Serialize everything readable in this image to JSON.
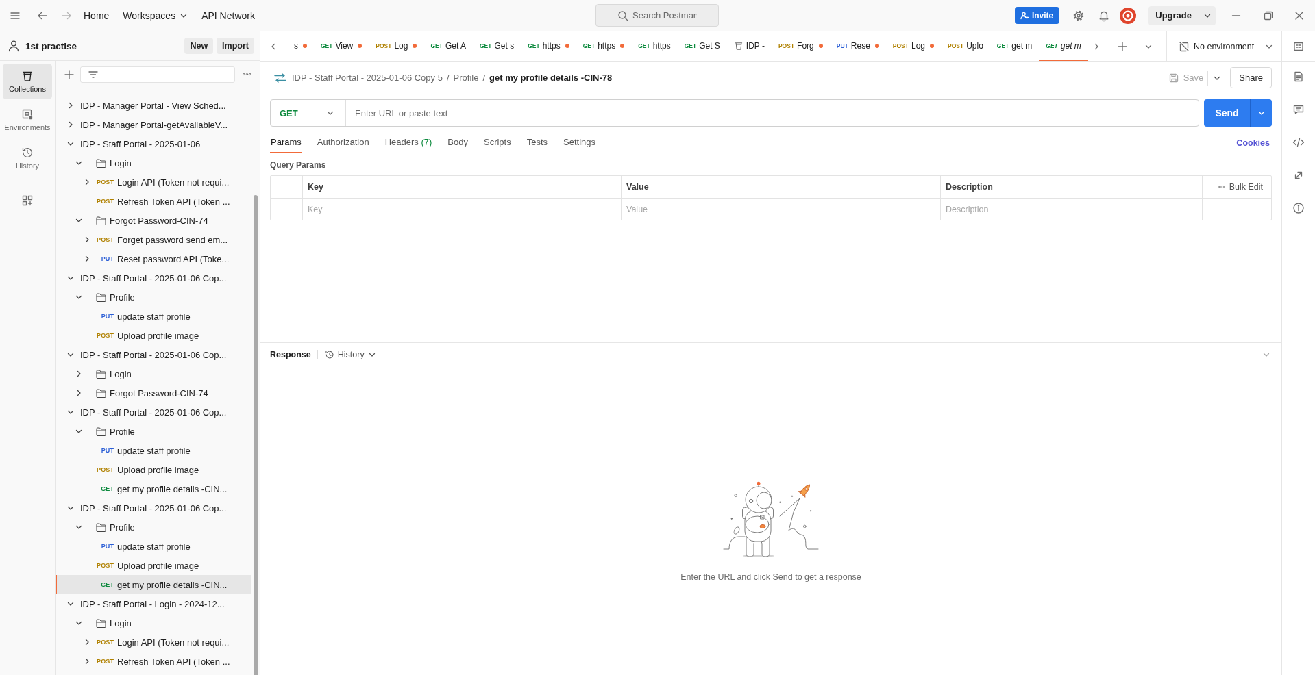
{
  "top_bar": {
    "nav": [
      {
        "label": "Home",
        "dropdown": false
      },
      {
        "label": "Workspaces",
        "dropdown": true
      },
      {
        "label": "API Network",
        "dropdown": false
      }
    ],
    "search": {
      "placeholder": "Search Postman"
    },
    "invite": "Invite",
    "upgrade": "Upgrade"
  },
  "sidebar": {
    "workspace": "1st practise",
    "new_button": "New",
    "import_button": "Import",
    "nav": [
      {
        "kind": "collections",
        "label": "Collections",
        "selected": true
      },
      {
        "kind": "environments",
        "label": "Environments",
        "selected": false
      },
      {
        "kind": "history",
        "label": "History",
        "selected": false
      }
    ],
    "tree": [
      {
        "kind": "collection",
        "label": "IDP - Manager Portal - View Sched...",
        "expanded": false,
        "selected": false
      },
      {
        "kind": "collection",
        "label": "IDP - Manager Portal-getAvailableV...",
        "expanded": false,
        "selected": false
      },
      {
        "kind": "collection",
        "label": "IDP - Staff Portal - 2025-01-06",
        "expanded": true,
        "selected": false,
        "children": [
          {
            "kind": "folder",
            "label": "Login",
            "expanded": true,
            "selected": false,
            "children": [
              {
                "kind": "request",
                "method": "POST",
                "label": "Login API (Token not requi...",
                "expandable": true,
                "selected": false
              },
              {
                "kind": "request",
                "method": "POST",
                "label": "Refresh Token API (Token ...",
                "expandable": false,
                "selected": false
              }
            ]
          },
          {
            "kind": "folder",
            "label": "Forgot Password-CIN-74",
            "expanded": true,
            "selected": false,
            "children": [
              {
                "kind": "request",
                "method": "POST",
                "label": "Forget password send em...",
                "expandable": true,
                "selected": false
              },
              {
                "kind": "request",
                "method": "PUT",
                "label": "Reset password API (Toke...",
                "expandable": true,
                "selected": false
              }
            ]
          }
        ]
      },
      {
        "kind": "collection",
        "label": "IDP - Staff Portal - 2025-01-06 Cop...",
        "expanded": true,
        "selected": false,
        "children": [
          {
            "kind": "folder",
            "label": "Profile",
            "expanded": true,
            "selected": false,
            "children": [
              {
                "kind": "request",
                "method": "PUT",
                "label": "update staff profile",
                "expandable": false,
                "selected": false
              },
              {
                "kind": "request",
                "method": "POST",
                "label": "Upload profile image",
                "expandable": false,
                "selected": false
              }
            ]
          }
        ]
      },
      {
        "kind": "collection",
        "label": "IDP - Staff Portal - 2025-01-06 Cop...",
        "expanded": true,
        "selected": false,
        "children": [
          {
            "kind": "folder",
            "label": "Login",
            "expanded": false,
            "selected": false
          },
          {
            "kind": "folder",
            "label": "Forgot Password-CIN-74",
            "expanded": false,
            "selected": false
          }
        ]
      },
      {
        "kind": "collection",
        "label": "IDP - Staff Portal - 2025-01-06 Cop...",
        "expanded": true,
        "selected": false,
        "children": [
          {
            "kind": "folder",
            "label": "Profile",
            "expanded": true,
            "selected": false,
            "children": [
              {
                "kind": "request",
                "method": "PUT",
                "label": "update staff profile",
                "expandable": false,
                "selected": false
              },
              {
                "kind": "request",
                "method": "POST",
                "label": "Upload profile image",
                "expandable": false,
                "selected": false
              },
              {
                "kind": "request",
                "method": "GET",
                "label": "get my profile details -CIN...",
                "expandable": false,
                "selected": false
              }
            ]
          }
        ]
      },
      {
        "kind": "collection",
        "label": "IDP - Staff Portal - 2025-01-06 Cop...",
        "expanded": true,
        "selected": false,
        "children": [
          {
            "kind": "folder",
            "label": "Profile",
            "expanded": true,
            "selected": false,
            "children": [
              {
                "kind": "request",
                "method": "PUT",
                "label": "update staff profile",
                "expandable": false,
                "selected": false
              },
              {
                "kind": "request",
                "method": "POST",
                "label": "Upload profile image",
                "expandable": false,
                "selected": false
              },
              {
                "kind": "request",
                "method": "GET",
                "label": "get my profile details -CIN...",
                "expandable": false,
                "selected": true
              }
            ]
          }
        ]
      },
      {
        "kind": "collection",
        "label": "IDP - Staff Portal - Login - 2024-12...",
        "expanded": true,
        "selected": false,
        "children": [
          {
            "kind": "folder",
            "label": "Login",
            "expanded": true,
            "selected": false,
            "children": [
              {
                "kind": "request",
                "method": "POST",
                "label": "Login API (Token not requi...",
                "expandable": true,
                "selected": false
              },
              {
                "kind": "request",
                "method": "POST",
                "label": "Refresh Token API (Token ...",
                "expandable": true,
                "selected": false
              }
            ]
          }
        ]
      }
    ]
  },
  "tabs": {
    "items": [
      {
        "kind": "request",
        "label": "s",
        "unsaved": true,
        "selected": false,
        "preview": false
      },
      {
        "kind": "request",
        "method": "GET",
        "label": "View",
        "unsaved": true,
        "selected": false,
        "preview": false
      },
      {
        "kind": "request",
        "method": "POST",
        "label": "Log",
        "unsaved": true,
        "selected": false,
        "preview": false
      },
      {
        "kind": "request",
        "method": "GET",
        "label": "Get A",
        "unsaved": false,
        "selected": false,
        "preview": false
      },
      {
        "kind": "request",
        "method": "GET",
        "label": "Get s",
        "unsaved": false,
        "selected": false,
        "preview": false
      },
      {
        "kind": "request",
        "method": "GET",
        "label": "https",
        "unsaved": true,
        "selected": false,
        "preview": false
      },
      {
        "kind": "request",
        "method": "GET",
        "label": "https",
        "unsaved": true,
        "selected": false,
        "preview": false
      },
      {
        "kind": "request",
        "method": "GET",
        "label": "https",
        "unsaved": false,
        "selected": false,
        "preview": false
      },
      {
        "kind": "request",
        "method": "GET",
        "label": "Get S",
        "unsaved": false,
        "selected": false,
        "preview": false
      },
      {
        "kind": "collection",
        "label": "IDP -",
        "unsaved": false,
        "selected": false,
        "preview": false
      },
      {
        "kind": "request",
        "method": "POST",
        "label": "Forg",
        "unsaved": true,
        "selected": false,
        "preview": false
      },
      {
        "kind": "request",
        "method": "PUT",
        "label": "Rese",
        "unsaved": true,
        "selected": false,
        "preview": false
      },
      {
        "kind": "request",
        "method": "POST",
        "label": "Log",
        "unsaved": true,
        "selected": false,
        "preview": false
      },
      {
        "kind": "request",
        "method": "POST",
        "label": "Uplo",
        "unsaved": false,
        "selected": false,
        "preview": false
      },
      {
        "kind": "request",
        "method": "GET",
        "label": "get m",
        "unsaved": false,
        "selected": false,
        "preview": false
      },
      {
        "kind": "request",
        "method": "GET",
        "label": "get m",
        "unsaved": false,
        "selected": true,
        "preview": true
      }
    ],
    "environment": "No environment"
  },
  "request": {
    "breadcrumb": [
      {
        "label": "IDP - Staff Portal - 2025-01-06 Copy 5",
        "separator": "/",
        "current": false
      },
      {
        "label": "Profile",
        "separator": "/",
        "current": false
      },
      {
        "label": "get my profile details -CIN-78",
        "current": true
      }
    ],
    "save": {
      "label": "Save",
      "disabled": true
    },
    "share": "Share",
    "method": "GET",
    "url": {
      "placeholder": "Enter URL or paste text"
    },
    "send": "Send",
    "tabs": [
      {
        "label": "Params",
        "selected": true
      },
      {
        "label": "Authorization",
        "selected": false
      },
      {
        "label": "Headers",
        "count": "(7)",
        "selected": false
      },
      {
        "label": "Body",
        "selected": false
      },
      {
        "label": "Scripts",
        "selected": false
      },
      {
        "label": "Tests",
        "selected": false
      },
      {
        "label": "Settings",
        "selected": false
      }
    ],
    "cookies": "Cookies",
    "query_params": {
      "title": "Query Params",
      "columns": [
        {
          "label": "Key",
          "placeholder": "Key"
        },
        {
          "label": "Value",
          "placeholder": "Value"
        },
        {
          "label": "Description",
          "placeholder": "Description"
        }
      ],
      "bulk_edit": "Bulk Edit"
    }
  },
  "response": {
    "title": "Response",
    "history": "History",
    "empty_message": "Enter the URL and click Send to get a response"
  }
}
